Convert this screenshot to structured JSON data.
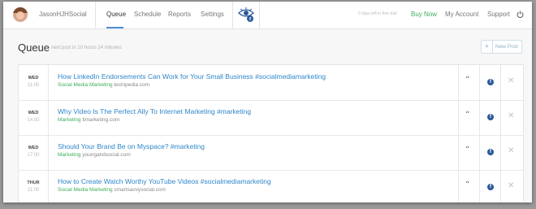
{
  "header": {
    "username": "JasonHJHSocial",
    "nav": [
      "Queue",
      "Schedule",
      "Reports",
      "Settings"
    ],
    "trial_text": "0 days left in free trial",
    "buy_now": "Buy Now",
    "my_account": "My Account",
    "support": "Support",
    "accent_color": "#4a90d9",
    "buy_color": "#3cae5d"
  },
  "queue": {
    "title": "Queue",
    "next_post": "next post in 10 hours 24 minutes",
    "new_post": "New Post"
  },
  "posts": [
    {
      "day": "WED",
      "time": "11:00",
      "title": "How LinkedIn Endorsements Can Work for Your Small Business #socialmediamarketing",
      "category": "Social Media Marketing",
      "domain": "techipedia.com"
    },
    {
      "day": "WED",
      "time": "14:00",
      "title": "Why Video Is The Perfect Ally To Internet Marketing #marketing",
      "category": "Marketing",
      "domain": "tlmarketing.com"
    },
    {
      "day": "WED",
      "time": "17:00",
      "title": "Should Your Brand Be on Myspace? #marketing",
      "category": "Marketing",
      "domain": "youngandsocial.com"
    },
    {
      "day": "THUR",
      "time": "11:00",
      "title": "How to Create Watch Worthy YouTube Videos #socialmediamarketing",
      "category": "Social Media Marketing",
      "domain": "smartsavvysocial.com"
    }
  ],
  "icons": {
    "quote": "quote-icon",
    "facebook": "facebook-icon",
    "close": "close-icon",
    "power": "power-icon",
    "eye": "eye-logo-icon"
  }
}
